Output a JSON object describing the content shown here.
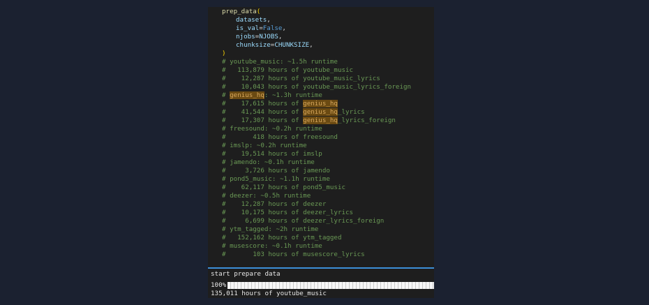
{
  "code": {
    "call_fn": "prep_data",
    "open_paren": "(",
    "args": [
      {
        "name": "datasets",
        "sep": ","
      },
      {
        "name": "is_val",
        "op": "=",
        "value": "False",
        "sep": ","
      },
      {
        "name": "njobs",
        "op": "=",
        "value": "NJOBS",
        "sep": ","
      },
      {
        "name": "chunksize",
        "op": "=",
        "value": "CHUNKSIZE",
        "sep": ","
      }
    ],
    "close_paren": ")",
    "comments": [
      "# youtube_music: ~1.5h runtime",
      "#   113,879 hours of youtube_music",
      "#    12,287 hours of youtube_music_lyrics",
      "#    10,043 hours of youtube_music_lyrics_foreign",
      "# genius_hq: ~1.3h runtime",
      "#    17,615 hours of genius_hq",
      "#    41,544 hours of genius_hq_lyrics",
      "#    17,307 hours of genius_hq_lyrics_foreign",
      "# freesound: ~0.2h runtime",
      "#       418 hours of freesound",
      "# imslp: ~0.2h runtime",
      "#    19,514 hours of imslp",
      "# jamendo: ~0.1h runtime",
      "#     3,726 hours of jamendo",
      "# pond5_music: ~1.1h runtime",
      "#    62,117 hours of pond5_music",
      "# deezer: ~0.5h runtime",
      "#    12,287 hours of deezer",
      "#    10,175 hours of deezer_lyrics",
      "#     6,699 hours of deezer_lyrics_foreign",
      "# ytm_tagged: ~2h runtime",
      "#   152,162 hours of ytm_tagged",
      "# musescore: ~0.1h runtime",
      "#       103 hours of musescore_lyrics"
    ],
    "highlight_term": "genius_hq"
  },
  "output": {
    "line1": "start prepare data",
    "progress_label": "100%|",
    "progress_fraction": 1.0,
    "line3": "135,011 hours of youtube_music"
  }
}
